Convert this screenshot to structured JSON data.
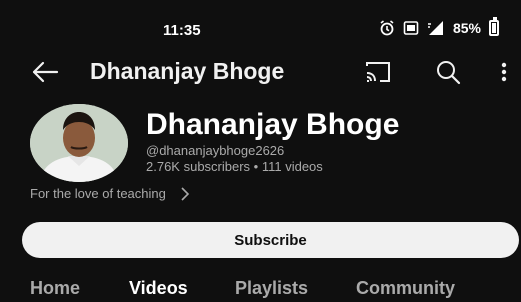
{
  "status_bar": {
    "time": "11:35",
    "battery": "85%",
    "icons": [
      "alarm-icon",
      "sim-icon",
      "signal-icon",
      "battery-icon"
    ]
  },
  "app_bar": {
    "title": "Dhananjay Bhoge",
    "icons": [
      "back-arrow-icon",
      "cast-icon",
      "search-icon",
      "more-vert-icon"
    ]
  },
  "channel": {
    "name": "Dhananjay Bhoge",
    "handle": "@dhananjaybhoge2626",
    "stats": "2.76K subscribers • 111 videos",
    "description": "For the love of teaching"
  },
  "subscribe_label": "Subscribe",
  "tabs": [
    {
      "label": "Home",
      "active": false
    },
    {
      "label": "Videos",
      "active": true
    },
    {
      "label": "Playlists",
      "active": false
    },
    {
      "label": "Community",
      "active": false
    }
  ],
  "colors": {
    "background": "#0f0f0f",
    "text_primary": "#f1f1f1",
    "text_secondary": "#aaaaaa",
    "subscribe_bg": "#f1f1f1"
  }
}
